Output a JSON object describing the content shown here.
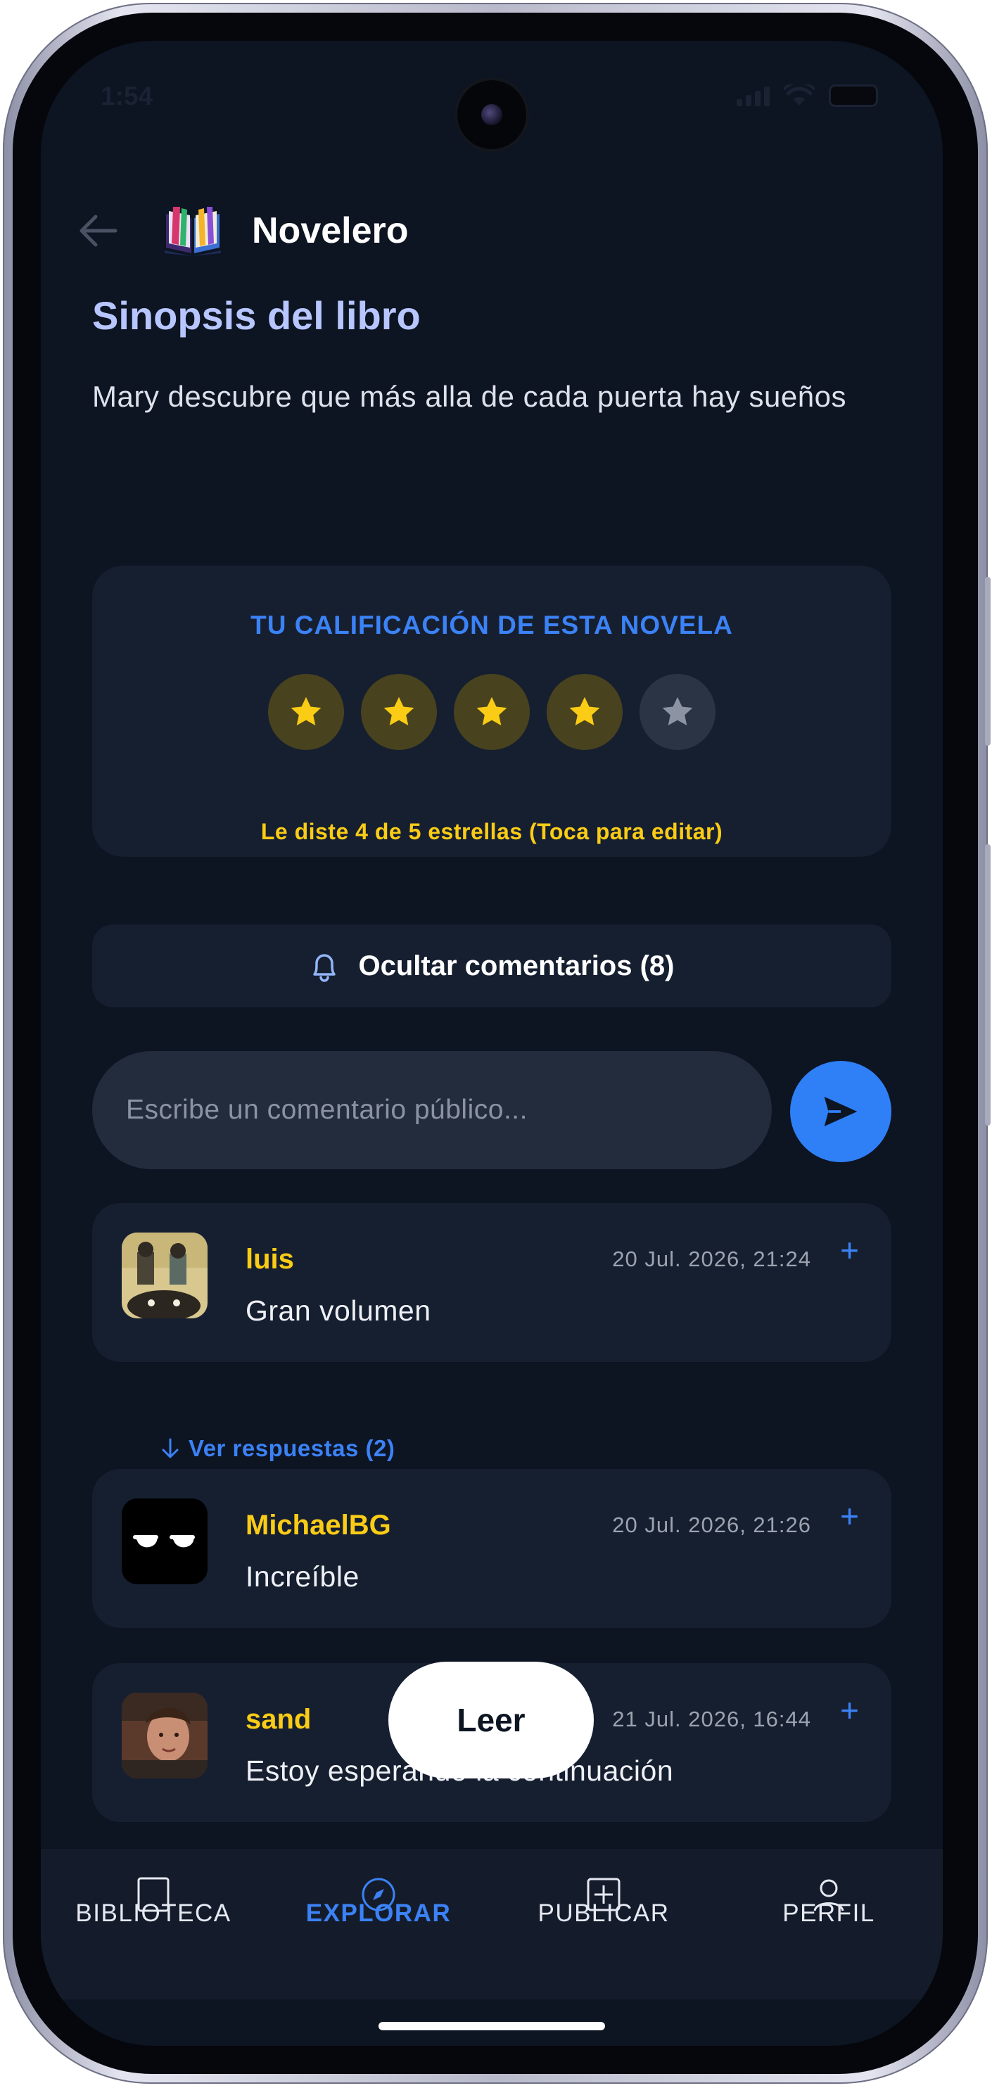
{
  "status_bar": {
    "time": "1:54"
  },
  "header": {
    "app_title": "Novelero"
  },
  "synopsis": {
    "title": "Sinopsis del libro",
    "text": "Mary descubre que más alla de cada puerta hay sueños"
  },
  "rating": {
    "title": "TU CALIFICACIÓN DE ESTA NOVELA",
    "value": 4,
    "max": 5,
    "note": "Le diste 4 de 5 estrellas (Toca para editar)"
  },
  "comments_toggle": {
    "label": "Ocultar comentarios (8)"
  },
  "comment_input": {
    "placeholder": "Escribe un comentario público..."
  },
  "comments": [
    {
      "user": "luis",
      "date": "20 Jul. 2026, 21:24",
      "text": "Gran volumen",
      "plus": "+"
    },
    {
      "user": "MichaelBG",
      "date": "20 Jul. 2026, 21:26",
      "text": "Increíble",
      "plus": "+"
    },
    {
      "user": "sand",
      "date": "21 Jul. 2026, 16:44",
      "text": "Estoy esperando la continuación",
      "plus": "+"
    }
  ],
  "replies_link": {
    "label": "Ver respuestas (2)"
  },
  "read_button": {
    "label": "Leer"
  },
  "bottom_nav": {
    "items": [
      {
        "label": "BIBLIOTECA",
        "icon": "book-icon"
      },
      {
        "label": "EXPLORAR",
        "icon": "compass-icon",
        "active": true
      },
      {
        "label": "PUBLICAR",
        "icon": "add-square-icon"
      },
      {
        "label": "PERFIL",
        "icon": "person-icon"
      }
    ]
  },
  "colors": {
    "background": "#0d1422",
    "card": "#161f30",
    "accent_blue": "#3b82f6",
    "accent_yellow": "#facc15",
    "synopsis_title": "#b7c6ff"
  }
}
